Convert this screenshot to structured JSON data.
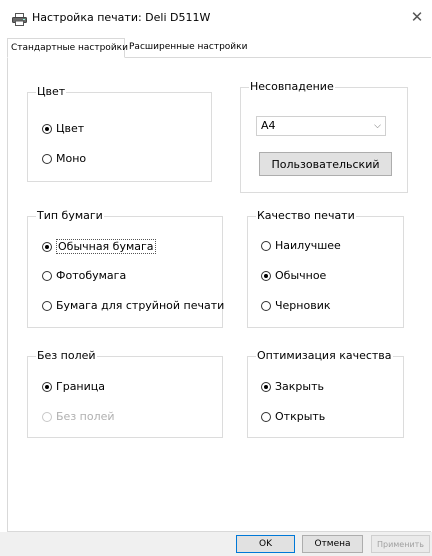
{
  "window": {
    "title": "Настройка печати: Deli D511W",
    "icon": "printer-icon",
    "close_glyph": "✕"
  },
  "tabs": [
    {
      "label": "Стандартные настройки",
      "active": true
    },
    {
      "label": "Расширенные настройки",
      "active": false
    }
  ],
  "color_group": {
    "title": "Цвет",
    "options": [
      {
        "label": "Цвет",
        "checked": true
      },
      {
        "label": "Моно",
        "checked": false
      }
    ]
  },
  "mismatch_group": {
    "title": "Несовпадение",
    "select_value": "А4",
    "custom_button": "Пользовательский"
  },
  "paper_group": {
    "title": "Тип бумаги",
    "options": [
      {
        "label": "Обычная бумага",
        "checked": true
      },
      {
        "label": "Фотобумага",
        "checked": false
      },
      {
        "label": "Бумага для струйной печати",
        "checked": false
      }
    ]
  },
  "quality_group": {
    "title": "Качество печати",
    "options": [
      {
        "label": "Наилучшее",
        "checked": false
      },
      {
        "label": "Обычное",
        "checked": true
      },
      {
        "label": "Черновик",
        "checked": false
      }
    ]
  },
  "borderless_group": {
    "title": "Без полей",
    "options": [
      {
        "label": "Граница",
        "checked": true
      },
      {
        "label": "Без полей",
        "checked": false,
        "disabled": true
      }
    ]
  },
  "optimization_group": {
    "title": "Оптимизация качества",
    "options": [
      {
        "label": "Закрыть",
        "checked": true
      },
      {
        "label": "Открыть",
        "checked": false
      }
    ]
  },
  "footer": {
    "ok": "OK",
    "cancel": "Отмена",
    "apply": "Применить"
  }
}
